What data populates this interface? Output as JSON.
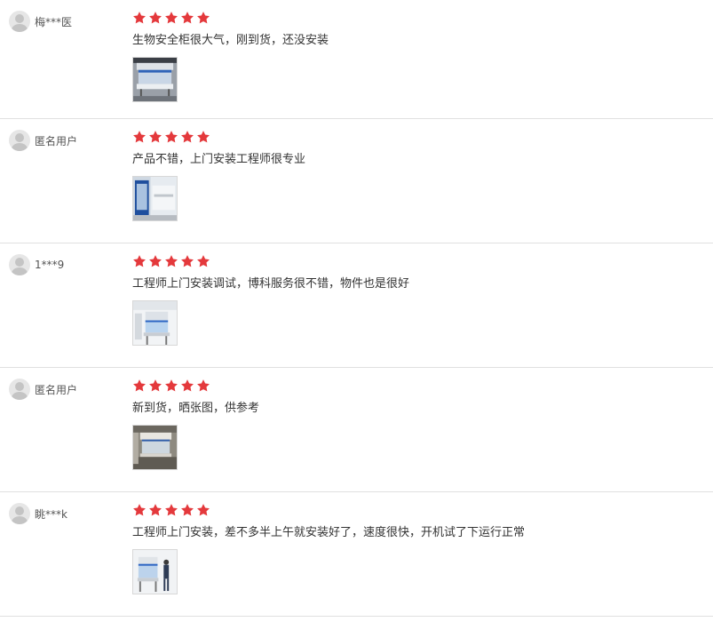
{
  "colors": {
    "star": "#e4393c",
    "divider": "#e0e0e0"
  },
  "reviews": [
    {
      "user": "梅***医",
      "rating": 5,
      "comment": "生物安全柜很大气，刚到货，还没安装"
    },
    {
      "user": "匿名用户",
      "rating": 5,
      "comment": "产品不错，上门安装工程师很专业"
    },
    {
      "user": "1***9",
      "rating": 5,
      "comment": "工程师上门安装调试，博科服务很不错，物件也是很好"
    },
    {
      "user": "匿名用户",
      "rating": 5,
      "comment": "新到货，晒张图，供参考"
    },
    {
      "user": "眺***k",
      "rating": 5,
      "comment": "工程师上门安装，差不多半上午就安装好了，速度很快，开机试了下运行正常"
    }
  ]
}
